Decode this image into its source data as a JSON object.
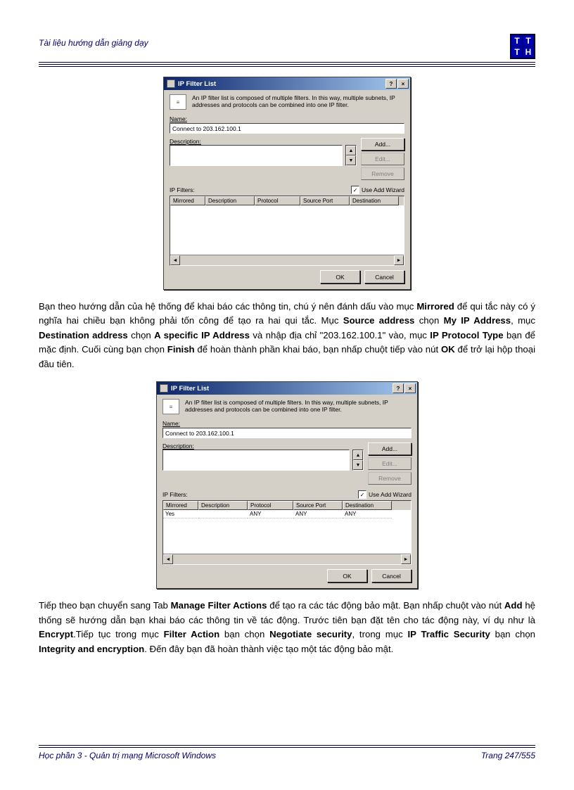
{
  "header": {
    "title": "Tài liệu hướng dẫn giảng dạy"
  },
  "logo": {
    "a": "T",
    "b": "T",
    "c": "T",
    "d": "H"
  },
  "dialog1": {
    "title": "IP Filter List",
    "helpBtn": "?",
    "closeBtn": "×",
    "intro": "An IP filter list is composed of multiple filters. In this way, multiple subnets, IP addresses and protocols can be combined into one IP filter.",
    "nameLabel": "Name:",
    "nameValue": "Connect to 203.162.100.1",
    "descLabel": "Description:",
    "addBtn": "Add...",
    "editBtn": "Edit...",
    "removeBtn": "Remove",
    "filtersLabel": "IP Filters:",
    "wizardCheck": "✓",
    "wizardLabel": "Use Add Wizard",
    "cols": {
      "c1": "Mirrored",
      "c2": "Description",
      "c3": "Protocol",
      "c4": "Source Port",
      "c5": "Destination"
    },
    "ok": "OK",
    "cancel": "Cancel"
  },
  "para1_a": "Bạn theo hướng dẫn của hệ thống để khai báo các thông tin, chú ý nên đánh dấu vào mục ",
  "para1_b": "Mirrored",
  "para1_c": " để qui tắc này có ý nghĩa hai chiều bạn không phải tốn công để tạo ra hai qui tắc. Mục ",
  "para1_d": "Source address",
  "para1_e": " chọn ",
  "para1_f": "My IP Address",
  "para1_g": ", mục ",
  "para1_h": "Destination address",
  "para1_i": " chọn ",
  "para1_j": "A specific IP Address",
  "para1_k": " và nhập địa chỉ \"203.162.100.1\" vào, mục ",
  "para1_l": "IP Protocol Type",
  "para1_m": " bạn để mặc định. Cuối cùng bạn chọn ",
  "para1_n": "Finish",
  "para1_o": " để hoàn thành phần khai báo, bạn nhấp chuột tiếp vào nút ",
  "para1_p": "OK",
  "para1_q": " để trở lại hộp thoại đầu tiên.",
  "dialog2": {
    "title": "IP Filter List",
    "helpBtn": "?",
    "closeBtn": "×",
    "intro": "An IP filter list is composed of multiple filters. In this way, multiple subnets, IP addresses and protocols can be combined into one IP filter.",
    "nameLabel": "Name:",
    "nameValue": "Connect to 203.162.100.1",
    "descLabel": "Description:",
    "addBtn": "Add...",
    "editBtn": "Edit...",
    "removeBtn": "Remove",
    "filtersLabel": "IP Filters:",
    "wizardCheck": "✓",
    "wizardLabel": "Use Add Wizard",
    "cols": {
      "c1": "Mirrored",
      "c2": "Description",
      "c3": "Protocol",
      "c4": "Source Port",
      "c5": "Destination"
    },
    "row": {
      "c1": "Yes",
      "c2": "",
      "c3": "ANY",
      "c4": "ANY",
      "c5": "ANY"
    },
    "ok": "OK",
    "cancel": "Cancel"
  },
  "para2_a": "Tiếp theo bạn chuyển sang Tab ",
  "para2_b": "Manage Filter Actions",
  "para2_c": " để tạo ra các tác động bảo mật. Bạn nhấp chuột vào nút ",
  "para2_d": "Add",
  "para2_e": " hệ thống sẽ hướng dẫn bạn khai báo các thông tin về tác động. Trước tiên bạn đặt tên cho tác động này, ví dụ như là ",
  "para2_f": "Encrypt",
  "para2_g": ".Tiếp tục trong mục ",
  "para2_h": "Filter Action",
  "para2_i": " bạn chọn ",
  "para2_j": "Negotiate security",
  "para2_k": ", trong mục ",
  "para2_l": "IP Traffic Security",
  "para2_m": " bạn chọn ",
  "para2_n": "Integrity and encryption",
  "para2_o": ". Đến đây bạn đã hoàn thành việc tạo một tác động bảo mật.",
  "footer": {
    "left": "Học phần 3 - Quản trị mạng Microsoft Windows",
    "right": "Trang 247/555"
  }
}
